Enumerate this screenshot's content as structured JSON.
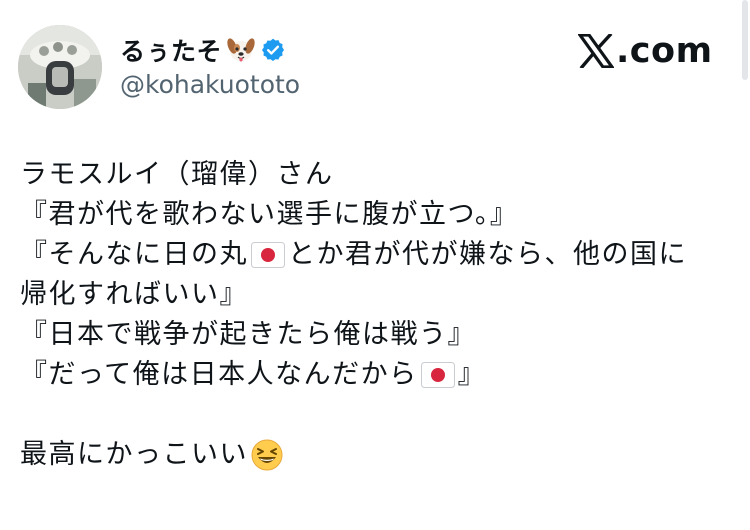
{
  "author": {
    "display_name": "るぅたそ",
    "name_emoji": "dog-face-icon",
    "verified_icon": "verified-badge-icon",
    "handle": "@kohakuototo",
    "badge_color": "#1d9bf0"
  },
  "brand": {
    "logo_text": ".com",
    "logo_icon": "x-logo-icon"
  },
  "tweet": {
    "line1": "ラモスルイ（瑠偉）さん",
    "line2": "『君が代を歌わない選手に腹が立つ。』",
    "line3_a": "『そんなに日の丸",
    "line3_b": "とか君が代が嫌なら、他の国に",
    "line4": "帰化すればいい』",
    "line5": "『日本で戦争が起きたら俺は戦う』",
    "line6_a": "『だって俺は日本人なんだから",
    "line6_b": "』",
    "line7": "最高にかっこいい"
  },
  "icons": {
    "flag": "japan-flag-icon",
    "laugh": "grinning-squinting-face-icon"
  }
}
